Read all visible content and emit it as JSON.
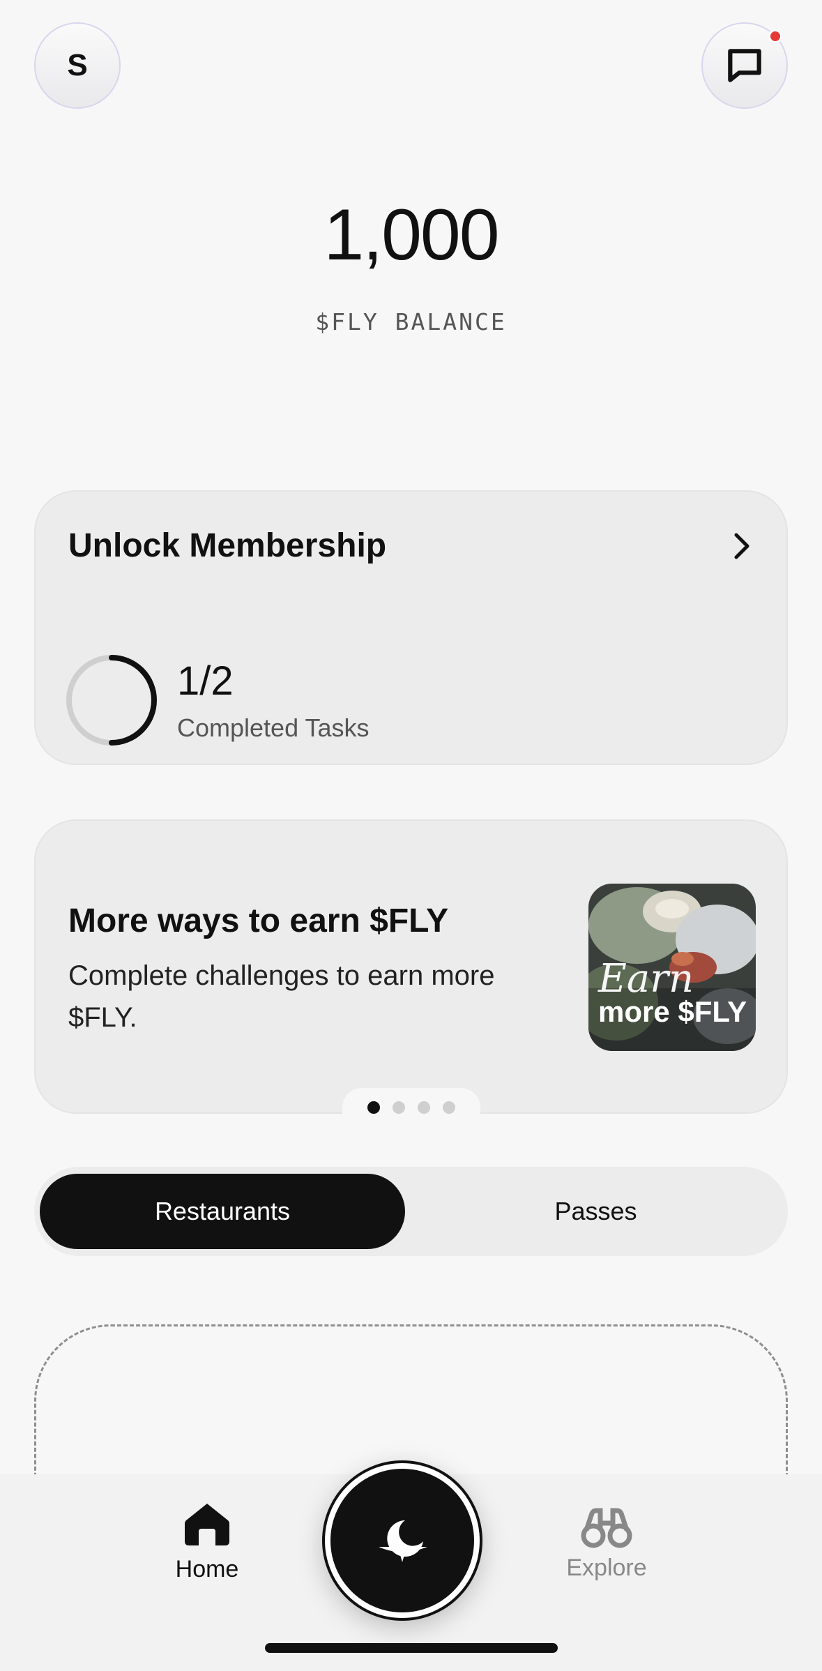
{
  "header": {
    "avatar_initial": "S",
    "messages_icon": "message-square-icon",
    "has_notification": true
  },
  "balance": {
    "value": "1,000",
    "label": "$FLY BALANCE"
  },
  "membership_card": {
    "title": "Unlock Membership",
    "progress_count": "1/2",
    "progress_label": "Completed Tasks",
    "progress_fraction": 0.5
  },
  "earn_card": {
    "title": "More ways to earn $FLY",
    "subtitle": "Complete challenges to earn more $FLY.",
    "thumbnail_script": "Earn",
    "thumbnail_bold": "more $FLY",
    "pager_total": 4,
    "pager_active": 1
  },
  "segmented": {
    "options": [
      "Restaurants",
      "Passes"
    ],
    "selected": "Restaurants"
  },
  "bottom_nav": {
    "home_label": "Home",
    "explore_label": "Explore",
    "center_icon": "flyer-logo-icon"
  },
  "colors": {
    "background": "#f7f7f7",
    "card": "#ececec",
    "primary": "#111111",
    "notification": "#e53935"
  }
}
